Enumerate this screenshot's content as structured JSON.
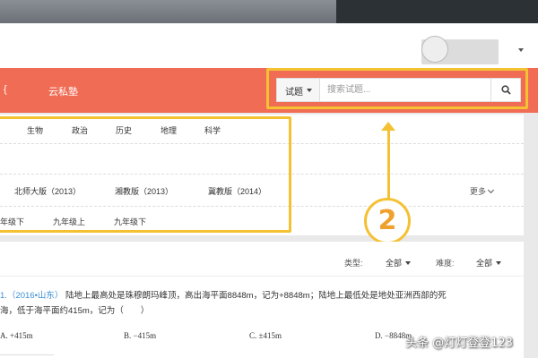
{
  "nav": {
    "items": [
      "云私塾"
    ]
  },
  "search": {
    "type_label": "试题",
    "placeholder": "搜索试题..."
  },
  "filters": {
    "subjects": [
      "生物",
      "政治",
      "历史",
      "地理",
      "科学"
    ],
    "editions": [
      "北师大版（2013）",
      "湘教版（2013）",
      "冀教版（2014）"
    ],
    "more_label": "更多",
    "grades": [
      "年级下",
      "九年级上",
      "九年级下"
    ]
  },
  "callout": {
    "number": "2"
  },
  "question_filters": {
    "type_label": "类型:",
    "type_value": "全部",
    "difficulty_label": "难度:",
    "difficulty_value": "全部"
  },
  "question": {
    "number": "1.",
    "source": "（2016•山东）",
    "line1": "陆地上最高处是珠穆朗玛峰顶，高出海平面8848m，记为+8848m；陆地上最低处是地处亚洲西部的死",
    "line2": "海，低于海平面约415m，记为（　　）",
    "options": [
      "A. +415m",
      "B. −415m",
      "C. ±415m",
      "D. −8848m"
    ]
  },
  "watermark": "头条 @灯灯登登123"
}
